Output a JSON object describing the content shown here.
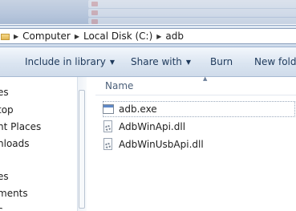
{
  "address_bar": {
    "crumbs": [
      "Computer",
      "Local Disk (C:)",
      "adb"
    ]
  },
  "toolbar": {
    "include_in_library": "Include in library",
    "share_with": "Share with",
    "burn": "Burn",
    "new_folder": "New folde"
  },
  "nav_pane": {
    "items": [
      "es",
      "top",
      "nt Places",
      "nloads",
      "es",
      "ments",
      "c"
    ]
  },
  "content": {
    "column_header": "Name",
    "files": [
      {
        "name": "adb.exe",
        "icon": "exe-icon"
      },
      {
        "name": "AdbWinApi.dll",
        "icon": "dll-icon"
      },
      {
        "name": "AdbWinUsbApi.dll",
        "icon": "dll-icon"
      }
    ]
  }
}
